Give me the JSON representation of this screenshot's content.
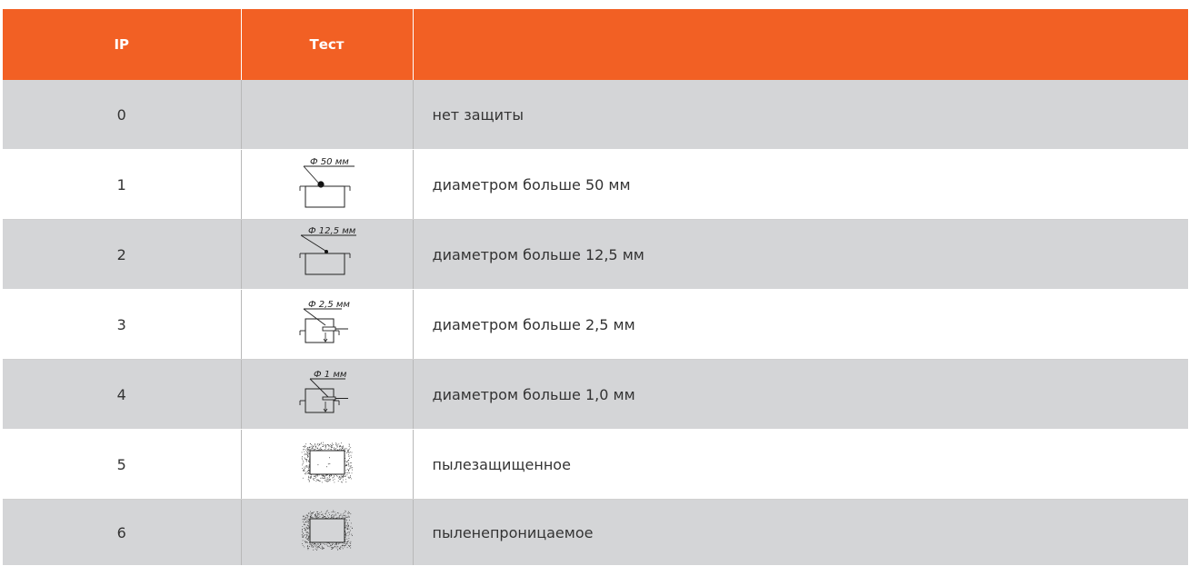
{
  "table": {
    "headers": {
      "ip": "IP",
      "test": "Тест",
      "description": ""
    },
    "rows": [
      {
        "ip": "0",
        "icon": "none",
        "description": "нет защиты"
      },
      {
        "ip": "1",
        "icon": "probe-50mm-icon",
        "icon_label": "Ф 50 мм",
        "description": "диаметром больше 50 мм"
      },
      {
        "ip": "2",
        "icon": "probe-12-5mm-icon",
        "icon_label": "Ф 12,5 мм",
        "description": "диаметром больше 12,5 мм"
      },
      {
        "ip": "3",
        "icon": "probe-2-5mm-icon",
        "icon_label": "Ф 2,5 мм",
        "description": "диаметром больше 2,5 мм"
      },
      {
        "ip": "4",
        "icon": "probe-1mm-icon",
        "icon_label": "Ф 1 мм",
        "description": "диаметром больше 1,0 мм"
      },
      {
        "ip": "5",
        "icon": "dust-protected-icon",
        "description": "пылезащищенное"
      },
      {
        "ip": "6",
        "icon": "dust-tight-icon",
        "description": "пыленепроницаемое"
      }
    ]
  },
  "colors": {
    "header_bg": "#f26024",
    "row_shade": "#d4d5d7",
    "text": "#333333"
  }
}
